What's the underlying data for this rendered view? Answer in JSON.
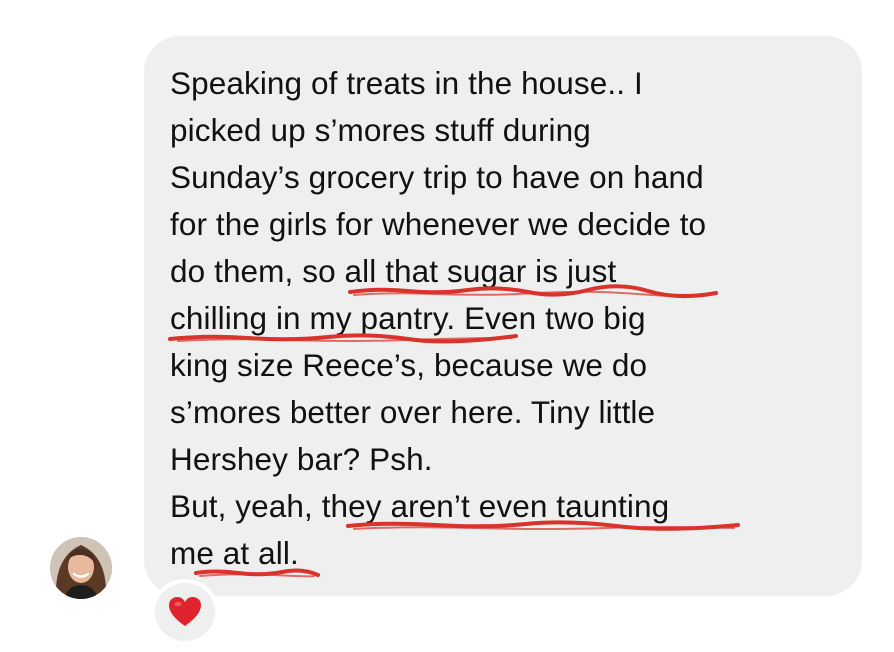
{
  "message": {
    "lines": [
      "Speaking of treats in the house.. I",
      "picked up s’mores stuff during",
      "Sunday’s grocery trip to have on hand",
      "for the girls for whenever we decide to",
      "do them, so all that sugar is just",
      "chilling in my pantry. Even two big",
      "king size Reece’s, because we do",
      "s’mores better over here. Tiny little",
      "Hershey bar? Psh.",
      "But, yeah, they aren’t even taunting",
      "me at all."
    ]
  },
  "sender": {
    "avatar_icon": "profile-photo"
  },
  "reaction": {
    "icon": "red-heart-icon",
    "color": "#e0242e"
  },
  "highlight": {
    "color": "#d9332b"
  }
}
